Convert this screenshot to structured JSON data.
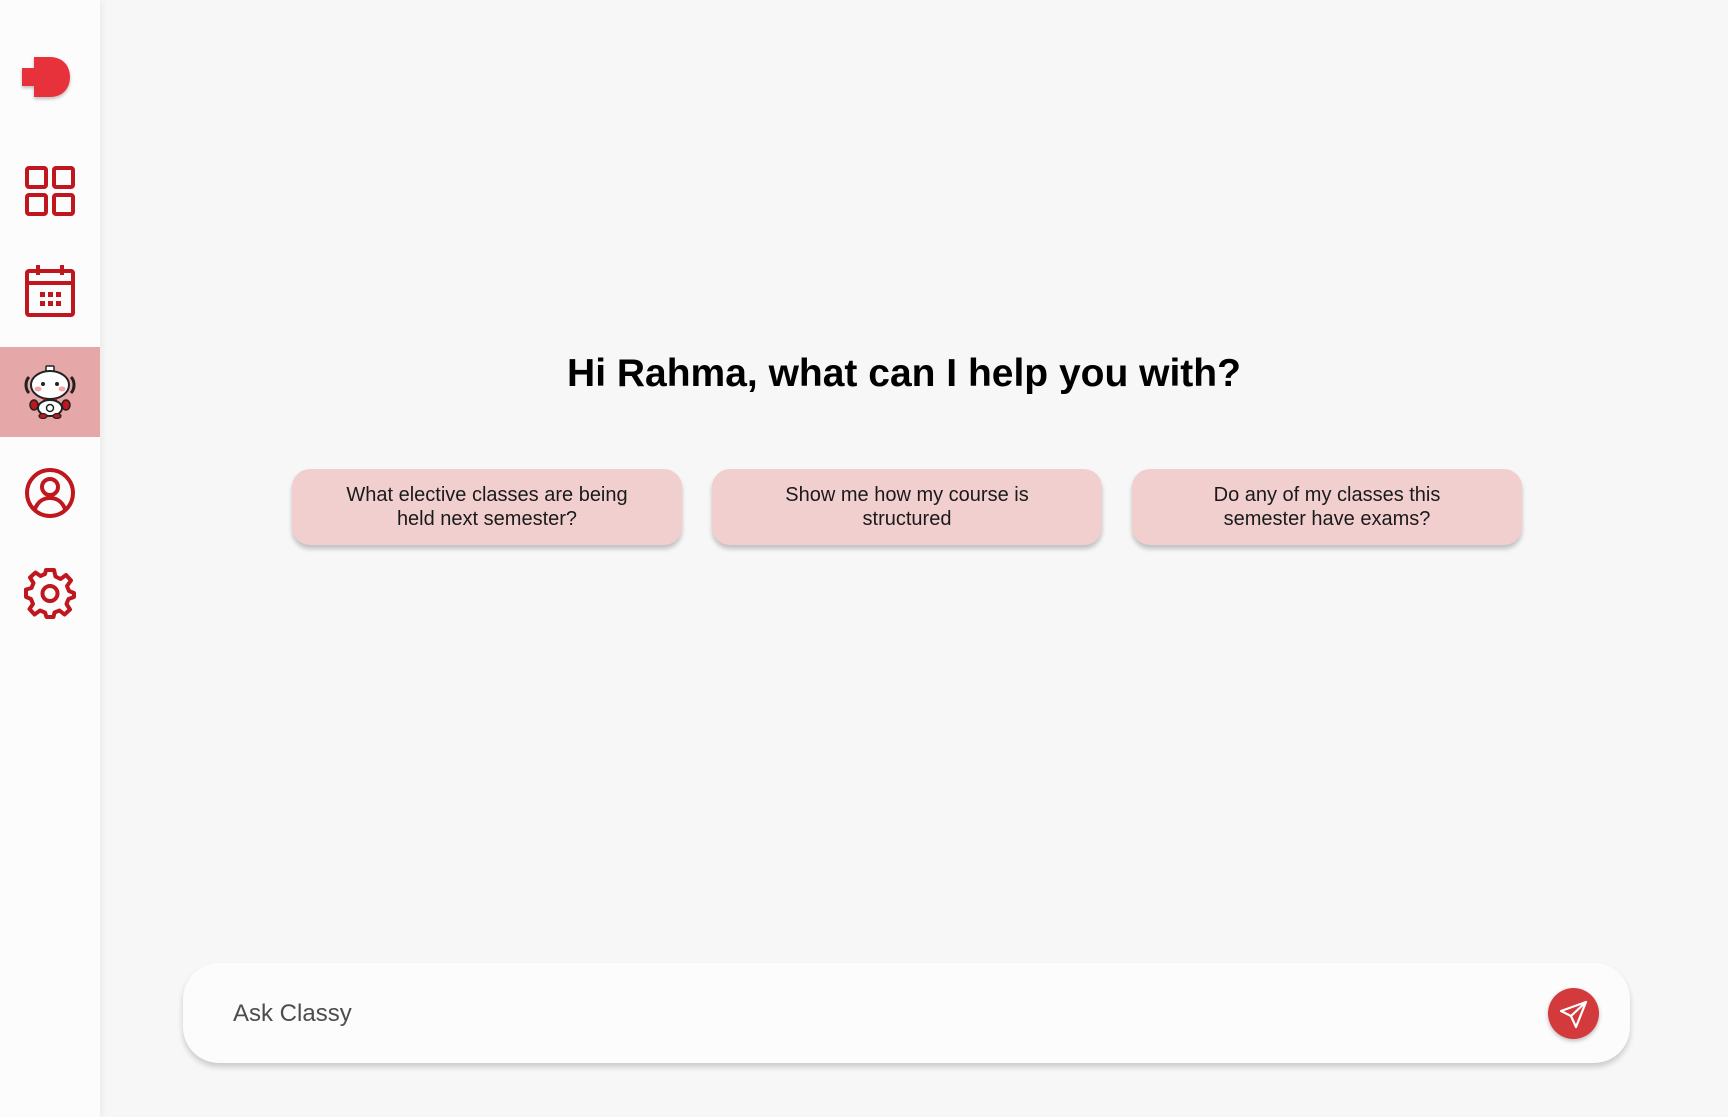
{
  "brand": {
    "logo_icon": "red-blob-logo-icon",
    "accent_color": "#c0161d",
    "active_nav_bg": "#e6a7a9",
    "suggestion_bg": "#f2cfcf",
    "send_button_color": "#d33a3c"
  },
  "sidebar": {
    "items": [
      {
        "icon": "dashboard-grid-icon",
        "active": false
      },
      {
        "icon": "calendar-icon",
        "active": false
      },
      {
        "icon": "robot-assistant-icon",
        "active": true
      },
      {
        "icon": "profile-user-icon",
        "active": false
      },
      {
        "icon": "settings-gear-icon",
        "active": false
      }
    ]
  },
  "main": {
    "greeting": "Hi Rahma, what can I help you with?",
    "suggestions": [
      "What elective classes are being held next semester?",
      "Show me how my course is structured",
      "Do any of my classes this semester have exams?"
    ]
  },
  "chat_input": {
    "placeholder": "Ask Classy",
    "value": "",
    "send_icon": "paper-plane-icon"
  }
}
